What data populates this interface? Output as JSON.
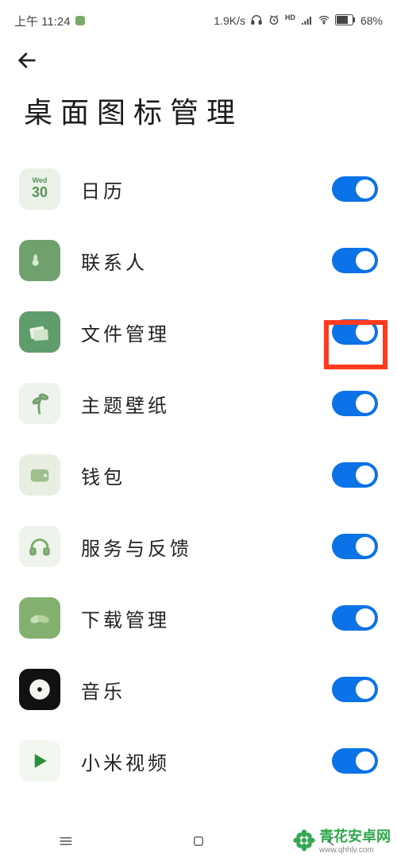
{
  "status": {
    "time": "上午 11:24",
    "net_speed": "1.9K/s",
    "battery": "68%"
  },
  "page": {
    "title": "桌面图标管理"
  },
  "apps": [
    {
      "label": "日历",
      "icon": "calendar",
      "on": true,
      "icon_text_top": "Wed",
      "icon_text_bottom": "30"
    },
    {
      "label": "联系人",
      "icon": "contacts",
      "on": true
    },
    {
      "label": "文件管理",
      "icon": "files",
      "on": true,
      "highlighted": true
    },
    {
      "label": "主题壁纸",
      "icon": "themes",
      "on": true
    },
    {
      "label": "钱包",
      "icon": "wallet",
      "on": true
    },
    {
      "label": "服务与反馈",
      "icon": "service",
      "on": true
    },
    {
      "label": "下载管理",
      "icon": "download",
      "on": true
    },
    {
      "label": "音乐",
      "icon": "music",
      "on": true
    },
    {
      "label": "小米视频",
      "icon": "video",
      "on": true
    }
  ],
  "watermark": {
    "brand": "青花安卓网",
    "url": "www.qhhlv.com"
  }
}
